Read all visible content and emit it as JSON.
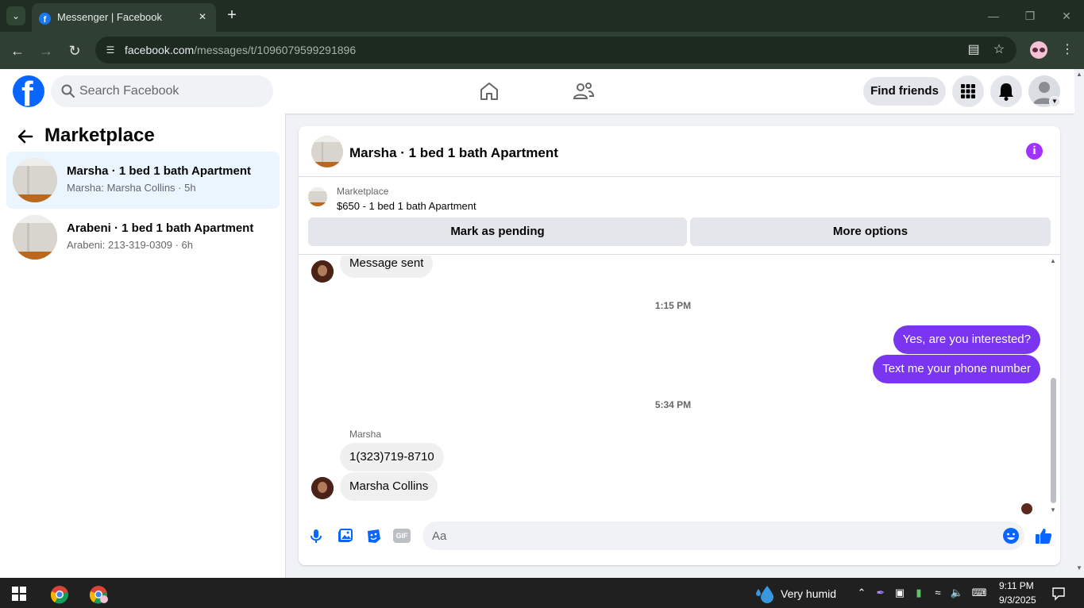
{
  "browser": {
    "tab_title": "Messenger | Facebook",
    "new_tab_symbol": "+",
    "url_host": "facebook.com",
    "url_path": "/messages/t/1096079599291896"
  },
  "fb_nav": {
    "search_placeholder": "Search Facebook",
    "find_friends_label": "Find friends"
  },
  "left_panel": {
    "title": "Marketplace",
    "conversations": [
      {
        "name": "Marsha · 1 bed 1 bath Apartment",
        "preview": "Marsha: Marsha Collins · 5h",
        "active": true
      },
      {
        "name": "Arabeni · 1 bed 1 bath Apartment",
        "preview": "Arabeni: 213-319-0309 · 6h",
        "active": false
      }
    ]
  },
  "chat": {
    "title": "Marsha · 1 bed 1 bath Apartment",
    "listing": {
      "source": "Marketplace",
      "price_title": "$650 - 1 bed 1 bath Apartment",
      "mark_pending_label": "Mark as pending",
      "more_options_label": "More options"
    },
    "messages": [
      {
        "type": "incoming",
        "text": "Message sent"
      },
      {
        "type": "timestamp",
        "text": "1:15 PM"
      },
      {
        "type": "outgoing",
        "text": "Yes, are you interested?"
      },
      {
        "type": "outgoing",
        "text": "Text me your phone number"
      },
      {
        "type": "timestamp",
        "text": "5:34 PM"
      },
      {
        "type": "sender",
        "text": "Marsha"
      },
      {
        "type": "incoming",
        "text": "1(323)719-8710"
      },
      {
        "type": "incoming",
        "text": "Marsha Collins"
      }
    ],
    "composer_placeholder": "Aa",
    "gif_label": "GIF"
  },
  "taskbar": {
    "weather": "Very humid",
    "time": "9:11 PM",
    "date": "9/3/2025"
  },
  "colors": {
    "fb_blue": "#0866ff",
    "outgoing_bubble": "#7a35f0",
    "info_purple": "#a033ff",
    "active_conv": "#ebf5ff"
  }
}
